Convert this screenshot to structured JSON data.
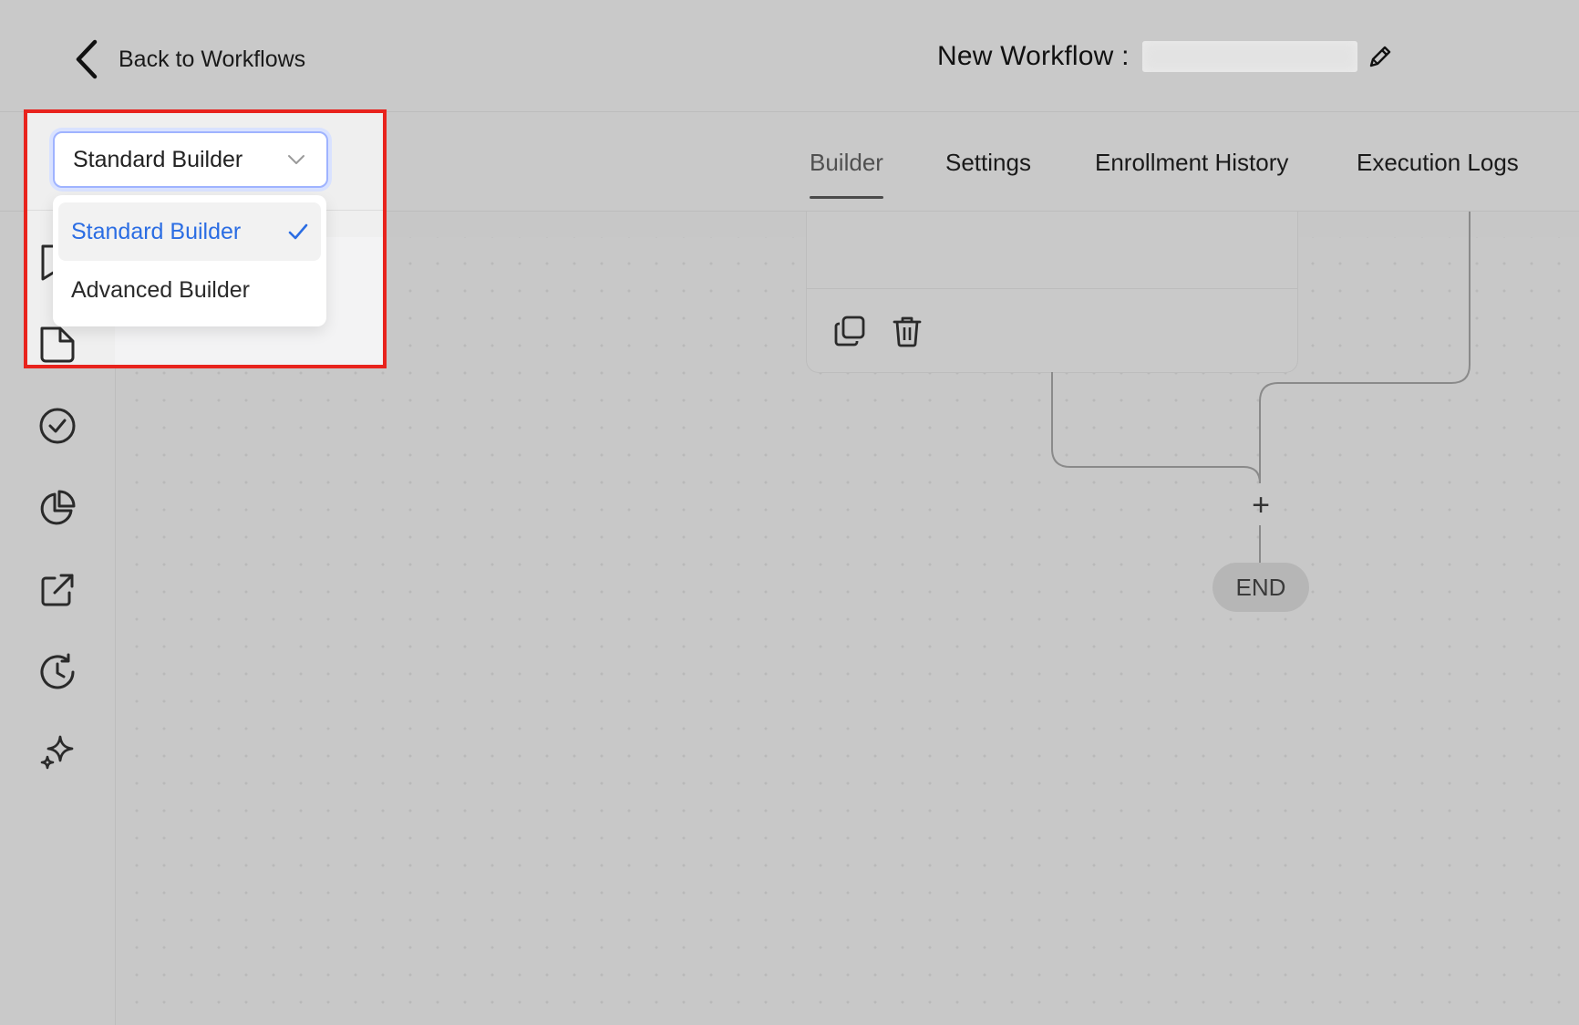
{
  "header": {
    "back_label": "Back to Workflows",
    "title_label": "New Workflow :",
    "title_value": ""
  },
  "tabs": [
    {
      "label": "Builder",
      "active": true
    },
    {
      "label": "Settings",
      "active": false
    },
    {
      "label": "Enrollment History",
      "active": false
    },
    {
      "label": "Execution Logs",
      "active": false
    }
  ],
  "builder_select": {
    "value": "Standard Builder",
    "options": [
      {
        "label": "Standard Builder",
        "selected": true
      },
      {
        "label": "Advanced Builder",
        "selected": false
      }
    ],
    "selected_color": "#2b6de3"
  },
  "sidebar": {
    "icons": [
      "bookmark-icon",
      "document-icon",
      "check-circle-icon",
      "pie-chart-icon",
      "external-link-icon",
      "history-clock-icon",
      "sparkles-icon"
    ]
  },
  "canvas": {
    "node_actions": [
      "copy-icon",
      "trash-icon"
    ],
    "add_step": "+",
    "end_label": "END"
  },
  "colors": {
    "highlight": "#e8231d",
    "background": "#c8c8c8"
  }
}
